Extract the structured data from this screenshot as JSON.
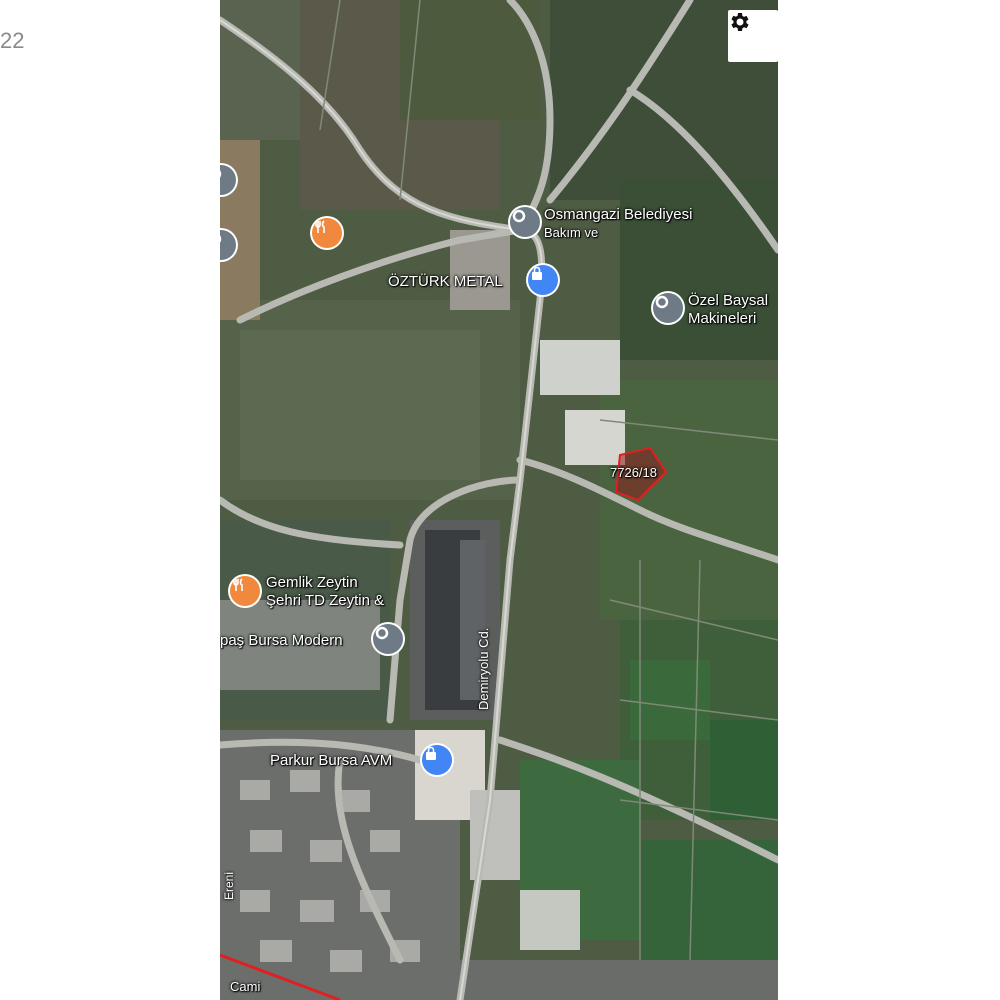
{
  "corner_text": "22",
  "settings": {
    "icon": "gear-icon",
    "color": "#111111"
  },
  "map": {
    "places": [
      {
        "id": "osmangazi",
        "name": "Osmangazi Belediyesi",
        "name_line2": "Bakım ve",
        "icon": "government-icon",
        "color": "#6e7b86"
      },
      {
        "id": "ozturk",
        "name": "ÖZTÜRK METAL",
        "icon": "shopping-bag-icon",
        "color": "#4285f4"
      },
      {
        "id": "baysal",
        "name": "Özel Baysal",
        "name_line2": "Makineleri",
        "icon": "government-icon",
        "color": "#6e7b86"
      },
      {
        "id": "parcel",
        "name": "7726/18"
      },
      {
        "id": "gemlik",
        "name": "Gemlik Zeytin",
        "name_line2": "Şehri TD Zeytin &",
        "icon": "restaurant-icon",
        "color": "#f0883e"
      },
      {
        "id": "bursa-modern",
        "name": "paş Bursa Modern",
        "icon": "government-icon",
        "color": "#6e7b86"
      },
      {
        "id": "parkur",
        "name": "Parkur Bursa AVM",
        "icon": "shopping-bag-icon",
        "color": "#4285f4"
      },
      {
        "id": "restaurant-top",
        "icon": "restaurant-icon",
        "color": "#f0883e"
      }
    ],
    "roads": [
      {
        "id": "demiryolu",
        "name": "Demiryolu Cd."
      },
      {
        "id": "cami",
        "name": "Cami"
      },
      {
        "id": "ereni",
        "name": "Ereni"
      }
    ],
    "parcel_outline_color": "#e02020"
  }
}
